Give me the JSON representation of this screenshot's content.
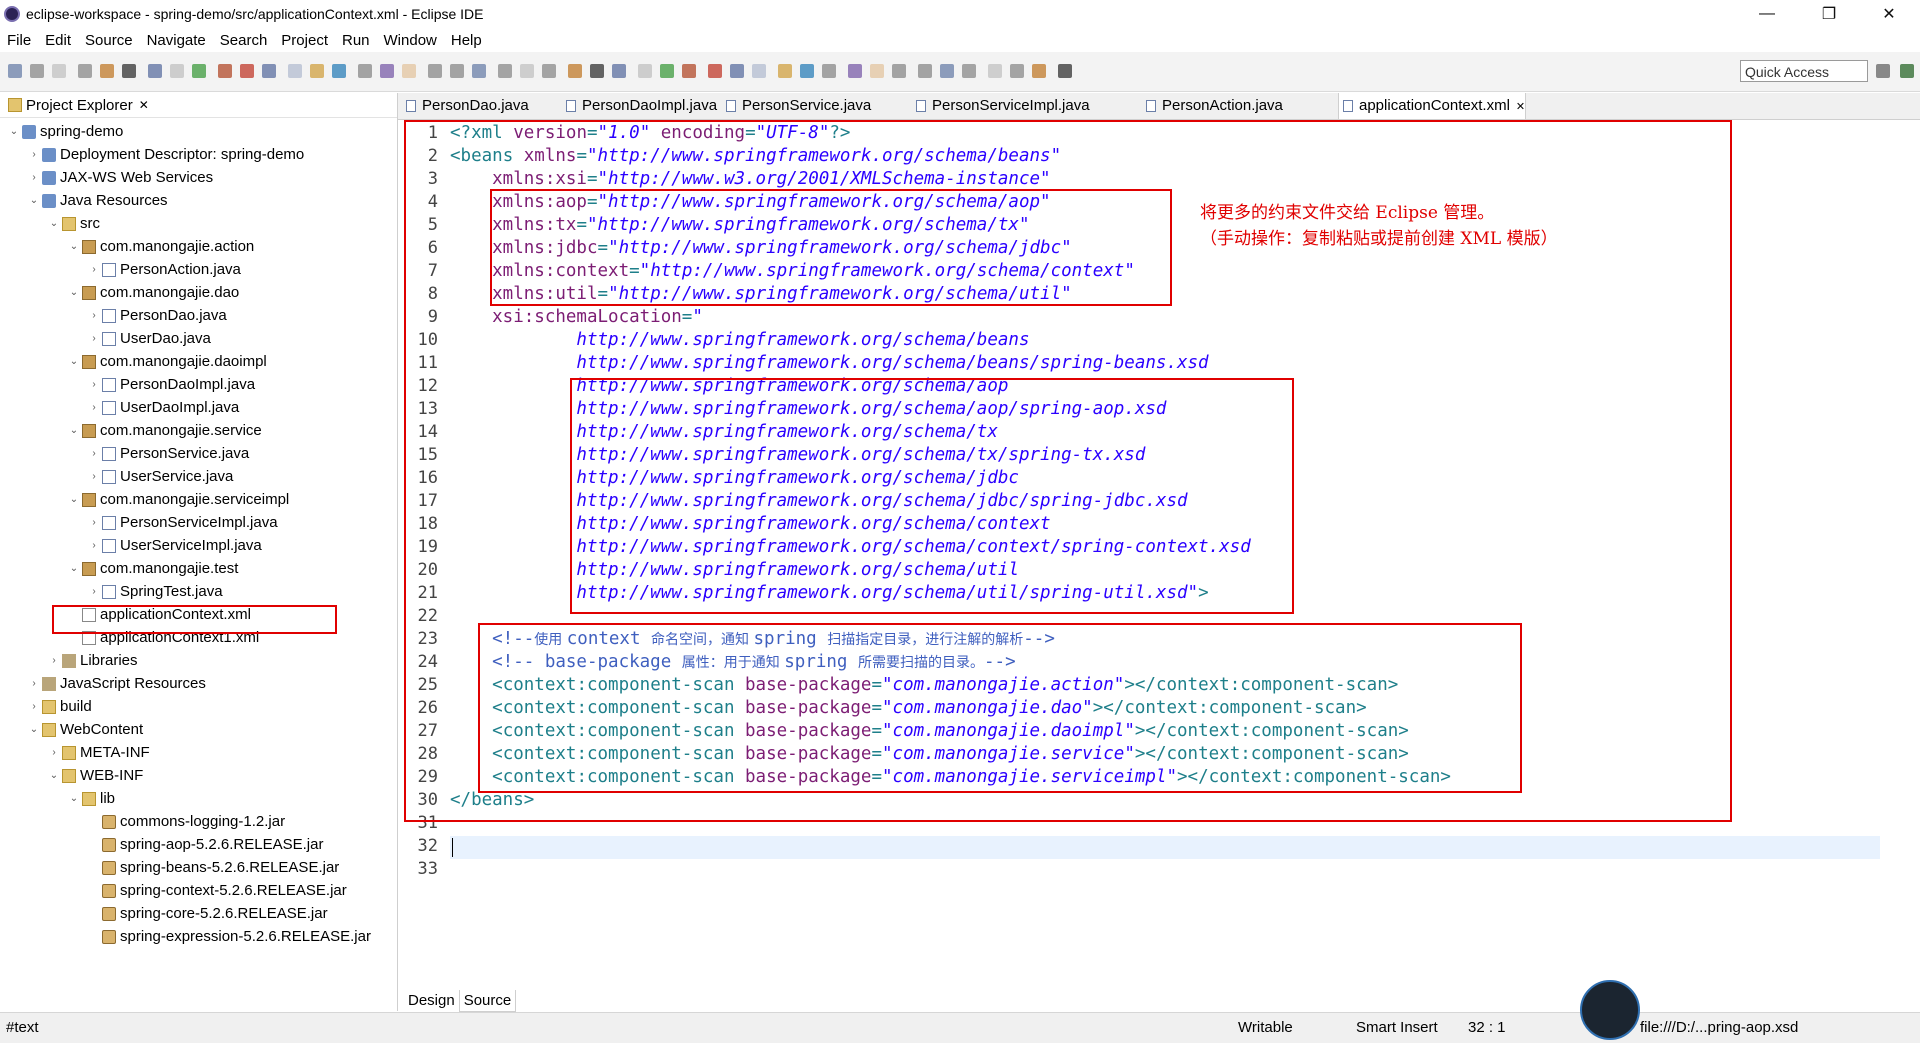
{
  "window": {
    "title": "eclipse-workspace - spring-demo/src/applicationContext.xml - Eclipse IDE",
    "minimize": "—",
    "restore": "❐",
    "close": "✕"
  },
  "menu": [
    "File",
    "Edit",
    "Source",
    "Navigate",
    "Search",
    "Project",
    "Run",
    "Window",
    "Help"
  ],
  "toolbar": {
    "quick_access": "Quick Access"
  },
  "explorer": {
    "title": "Project Explorer",
    "close": "✕",
    "items": [
      {
        "label": "spring-demo",
        "arrow": "⌄",
        "icon": "project"
      },
      {
        "label": "Deployment Descriptor: spring-demo",
        "arrow": "›",
        "icon": "project"
      },
      {
        "label": "JAX-WS Web Services",
        "arrow": "›",
        "icon": "project"
      },
      {
        "label": "Java Resources",
        "arrow": "⌄",
        "icon": "project"
      },
      {
        "label": "src",
        "arrow": "⌄",
        "icon": "folder"
      },
      {
        "label": "com.manongajie.action",
        "arrow": "⌄",
        "icon": "package"
      },
      {
        "label": "PersonAction.java",
        "arrow": "›",
        "icon": "java"
      },
      {
        "label": "com.manongajie.dao",
        "arrow": "⌄",
        "icon": "package"
      },
      {
        "label": "PersonDao.java",
        "arrow": "›",
        "icon": "java"
      },
      {
        "label": "UserDao.java",
        "arrow": "›",
        "icon": "java"
      },
      {
        "label": "com.manongajie.daoimpl",
        "arrow": "⌄",
        "icon": "package"
      },
      {
        "label": "PersonDaoImpl.java",
        "arrow": "›",
        "icon": "java"
      },
      {
        "label": "UserDaoImpl.java",
        "arrow": "›",
        "icon": "java"
      },
      {
        "label": "com.manongajie.service",
        "arrow": "⌄",
        "icon": "package"
      },
      {
        "label": "PersonService.java",
        "arrow": "›",
        "icon": "java"
      },
      {
        "label": "UserService.java",
        "arrow": "›",
        "icon": "java"
      },
      {
        "label": "com.manongajie.serviceimpl",
        "arrow": "⌄",
        "icon": "package"
      },
      {
        "label": "PersonServiceImpl.java",
        "arrow": "›",
        "icon": "java"
      },
      {
        "label": "UserServiceImpl.java",
        "arrow": "›",
        "icon": "java"
      },
      {
        "label": "com.manongajie.test",
        "arrow": "⌄",
        "icon": "package"
      },
      {
        "label": "SpringTest.java",
        "arrow": "›",
        "icon": "java"
      },
      {
        "label": "applicationContext.xml",
        "arrow": "",
        "icon": "xml"
      },
      {
        "label": "applicationContext1.xml",
        "arrow": "",
        "icon": "xml"
      },
      {
        "label": "Libraries",
        "arrow": "›",
        "icon": "lib"
      },
      {
        "label": "JavaScript Resources",
        "arrow": "›",
        "icon": "lib"
      },
      {
        "label": "build",
        "arrow": "›",
        "icon": "folder"
      },
      {
        "label": "WebContent",
        "arrow": "⌄",
        "icon": "folder"
      },
      {
        "label": "META-INF",
        "arrow": "›",
        "icon": "folder"
      },
      {
        "label": "WEB-INF",
        "arrow": "⌄",
        "icon": "folder"
      },
      {
        "label": "lib",
        "arrow": "⌄",
        "icon": "folder"
      },
      {
        "label": "commons-logging-1.2.jar",
        "arrow": "",
        "icon": "jar"
      },
      {
        "label": "spring-aop-5.2.6.RELEASE.jar",
        "arrow": "",
        "icon": "jar"
      },
      {
        "label": "spring-beans-5.2.6.RELEASE.jar",
        "arrow": "",
        "icon": "jar"
      },
      {
        "label": "spring-context-5.2.6.RELEASE.jar",
        "arrow": "",
        "icon": "jar"
      },
      {
        "label": "spring-core-5.2.6.RELEASE.jar",
        "arrow": "",
        "icon": "jar"
      },
      {
        "label": "spring-expression-5.2.6.RELEASE.jar",
        "arrow": "",
        "icon": "jar"
      }
    ]
  },
  "editor_tabs": [
    {
      "label": "PersonDao.java",
      "active": false
    },
    {
      "label": "PersonDaoImpl.java",
      "active": false
    },
    {
      "label": "PersonService.java",
      "active": false
    },
    {
      "label": "PersonServiceImpl.java",
      "active": false
    },
    {
      "label": "PersonAction.java",
      "active": false
    },
    {
      "label": "applicationContext.xml",
      "active": true
    }
  ],
  "tab_close": "✕",
  "code": [
    [
      [
        "p",
        "<?"
      ],
      [
        "t",
        "xml "
      ],
      [
        "a",
        "version"
      ],
      [
        "p",
        "="
      ],
      [
        "s",
        "\"1.0\""
      ],
      [
        "a",
        " encoding"
      ],
      [
        "p",
        "="
      ],
      [
        "s",
        "\"UTF-8\""
      ],
      [
        "p",
        "?>"
      ]
    ],
    [
      [
        "p",
        "<"
      ],
      [
        "t",
        "beans "
      ],
      [
        "a",
        "xmlns"
      ],
      [
        "p",
        "="
      ],
      [
        "s",
        "\"http://www.springframework.org/schema/beans\""
      ]
    ],
    [
      [
        "a",
        "    xmlns:xsi"
      ],
      [
        "p",
        "="
      ],
      [
        "s",
        "\"http://www.w3.org/2001/XMLSchema-instance\""
      ]
    ],
    [
      [
        "a",
        "    xmlns:aop"
      ],
      [
        "p",
        "="
      ],
      [
        "s",
        "\"http://www.springframework.org/schema/aop\""
      ]
    ],
    [
      [
        "a",
        "    xmlns:tx"
      ],
      [
        "p",
        "="
      ],
      [
        "s",
        "\"http://www.springframework.org/schema/tx\""
      ]
    ],
    [
      [
        "a",
        "    xmlns:jdbc"
      ],
      [
        "p",
        "="
      ],
      [
        "s",
        "\"http://www.springframework.org/schema/jdbc\""
      ]
    ],
    [
      [
        "a",
        "    xmlns:context"
      ],
      [
        "p",
        "="
      ],
      [
        "s",
        "\"http://www.springframework.org/schema/context\""
      ]
    ],
    [
      [
        "a",
        "    xmlns:util"
      ],
      [
        "p",
        "="
      ],
      [
        "s",
        "\"http://www.springframework.org/schema/util\""
      ]
    ],
    [
      [
        "a",
        "    xsi:schemaLocation"
      ],
      [
        "p",
        "="
      ],
      [
        "s",
        "\""
      ]
    ],
    [
      [
        "s",
        "            http://www.springframework.org/schema/beans"
      ]
    ],
    [
      [
        "s",
        "            http://www.springframework.org/schema/beans/spring-beans.xsd"
      ]
    ],
    [
      [
        "s",
        "            http://www.springframework.org/schema/aop"
      ]
    ],
    [
      [
        "s",
        "            http://www.springframework.org/schema/aop/spring-aop.xsd"
      ]
    ],
    [
      [
        "s",
        "            http://www.springframework.org/schema/tx"
      ]
    ],
    [
      [
        "s",
        "            http://www.springframework.org/schema/tx/spring-tx.xsd"
      ]
    ],
    [
      [
        "s",
        "            http://www.springframework.org/schema/jdbc"
      ]
    ],
    [
      [
        "s",
        "            http://www.springframework.org/schema/jdbc/spring-jdbc.xsd"
      ]
    ],
    [
      [
        "s",
        "            http://www.springframework.org/schema/context"
      ]
    ],
    [
      [
        "s",
        "            http://www.springframework.org/schema/context/spring-context.xsd"
      ]
    ],
    [
      [
        "s",
        "            http://www.springframework.org/schema/util"
      ]
    ],
    [
      [
        "s",
        "            http://www.springframework.org/schema/util/spring-util.xsd\""
      ],
      [
        "p",
        ">"
      ]
    ],
    [],
    [
      [
        "c",
        "    <!--"
      ],
      [
        "cs",
        "使用 "
      ],
      [
        "c",
        "context "
      ],
      [
        "cs",
        "命名空间，通知 "
      ],
      [
        "c",
        "spring "
      ],
      [
        "cs",
        "扫描指定目录，进行注解的解析"
      ],
      [
        "c",
        "-->"
      ]
    ],
    [
      [
        "c",
        "    <!-- base-package "
      ],
      [
        "cs",
        "属性：用于通知 "
      ],
      [
        "c",
        "spring "
      ],
      [
        "cs",
        "所需要扫描的目录。"
      ],
      [
        "c",
        "-->"
      ]
    ],
    [
      [
        "p",
        "    <"
      ],
      [
        "t",
        "context:component-scan "
      ],
      [
        "a",
        "base-package"
      ],
      [
        "p",
        "="
      ],
      [
        "s",
        "\"com.manongajie.action\""
      ],
      [
        "p",
        "></"
      ],
      [
        "t",
        "context:component-scan"
      ],
      [
        "p",
        ">"
      ]
    ],
    [
      [
        "p",
        "    <"
      ],
      [
        "t",
        "context:component-scan "
      ],
      [
        "a",
        "base-package"
      ],
      [
        "p",
        "="
      ],
      [
        "s",
        "\"com.manongajie.dao\""
      ],
      [
        "p",
        "></"
      ],
      [
        "t",
        "context:component-scan"
      ],
      [
        "p",
        ">"
      ]
    ],
    [
      [
        "p",
        "    <"
      ],
      [
        "t",
        "context:component-scan "
      ],
      [
        "a",
        "base-package"
      ],
      [
        "p",
        "="
      ],
      [
        "s",
        "\"com.manongajie.daoimpl\""
      ],
      [
        "p",
        "></"
      ],
      [
        "t",
        "context:component-scan"
      ],
      [
        "p",
        ">"
      ]
    ],
    [
      [
        "p",
        "    <"
      ],
      [
        "t",
        "context:component-scan "
      ],
      [
        "a",
        "base-package"
      ],
      [
        "p",
        "="
      ],
      [
        "s",
        "\"com.manongajie.service\""
      ],
      [
        "p",
        "></"
      ],
      [
        "t",
        "context:component-scan"
      ],
      [
        "p",
        ">"
      ]
    ],
    [
      [
        "p",
        "    <"
      ],
      [
        "t",
        "context:component-scan "
      ],
      [
        "a",
        "base-package"
      ],
      [
        "p",
        "="
      ],
      [
        "s",
        "\"com.manongajie.serviceimpl\""
      ],
      [
        "p",
        "></"
      ],
      [
        "t",
        "context:component-scan"
      ],
      [
        "p",
        ">"
      ]
    ],
    [
      [
        "p",
        "</"
      ],
      [
        "t",
        "beans"
      ],
      [
        "p",
        ">"
      ]
    ],
    [],
    [],
    []
  ],
  "annotation": {
    "line1": "将更多的约束文件交给 Eclipse 管理。",
    "line2": "（手动操作：复制粘贴或提前创建 XML 模版）"
  },
  "bottom_tabs": [
    "Design",
    "Source"
  ],
  "status": {
    "left": "#text",
    "writable": "Writable",
    "insert": "Smart Insert",
    "position": "32 : 1",
    "task": "file:///D:/...pring-aop.xsd"
  },
  "colors": {
    "highlight_box": "#e00000",
    "tag": "#1e7f8a",
    "attr": "#7c1d74",
    "string": "#2a00ff",
    "comment": "#3f5fbf"
  }
}
